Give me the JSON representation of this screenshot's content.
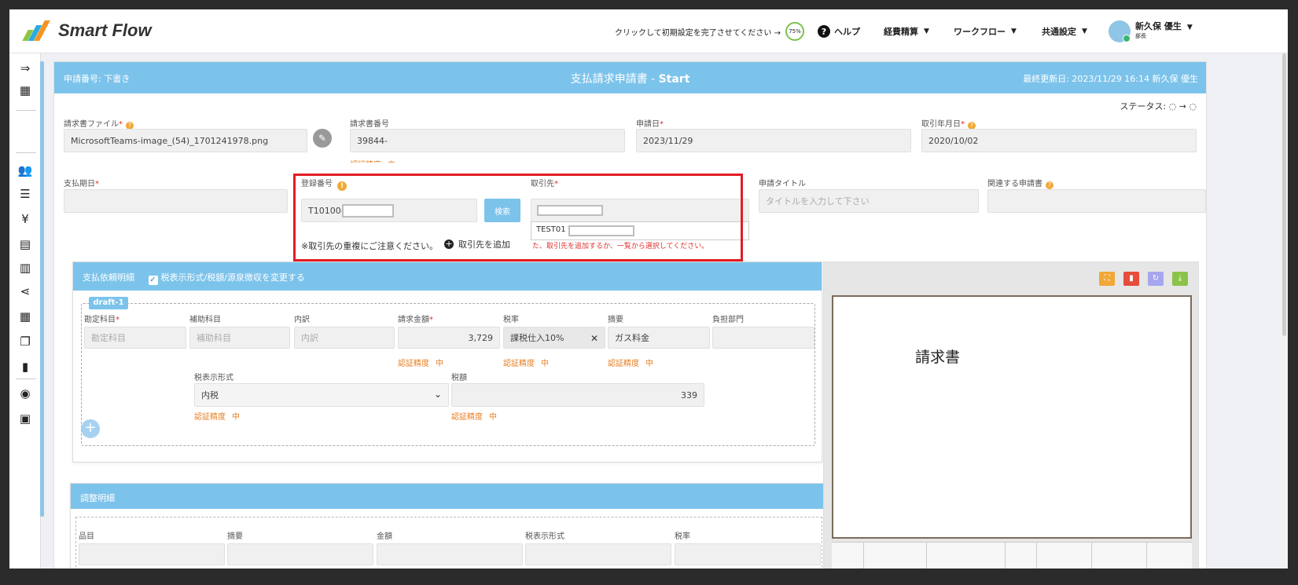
{
  "header": {
    "logo_text": "Smart Flow",
    "setup_prompt": "クリックして初期設定を完了させてください →",
    "setup_progress": "75%",
    "help": "ヘルプ",
    "menus": [
      "経費精算",
      "ワークフロー",
      "共通設定"
    ],
    "user_name": "新久保 優生",
    "user_role": "部長"
  },
  "app": {
    "number": "申請番号: 下書き",
    "title_prefix": "支払請求申請書 - ",
    "title_state": "Start",
    "last_updated": "最終更新日: 2023/11/29 16:14 新久保 優生",
    "status_label": "ステータス:"
  },
  "fields": {
    "invoice_file_label": "請求書ファイル",
    "invoice_file_value": "MicrosoftTeams-image_(54)_1701241978.png",
    "invoice_number_label": "請求書番号",
    "invoice_number_value": "39844-",
    "accuracy_text": "認証精度",
    "accuracy_level": "中",
    "application_date_label": "申請日",
    "application_date_value": "2023/11/29",
    "transaction_date_label": "取引年月日",
    "transaction_date_value": "2020/10/02",
    "payment_due_label": "支払期日",
    "registration_label": "登録番号",
    "registration_value": "T10100(",
    "search_button": "検索",
    "partner_label": "取引先",
    "partner_dropdown_item": "TEST01 :",
    "partner_note": "※取引先の重複にご注意ください。",
    "add_partner": "取引先を追加",
    "partner_hint": "た、取引先を追加するか、一覧から選択してください。",
    "request_title_label": "申請タイトル",
    "request_title_placeholder": "タイトルを入力して下さい",
    "related_label": "関連する申請書"
  },
  "payment_detail": {
    "header": "支払依頼明細",
    "checkbox_label": "税表示形式/税額/源泉徴収を変更する",
    "draft_tag": "draft-1",
    "columns": [
      "勘定科目",
      "補助科目",
      "内訳",
      "請求金額",
      "税率",
      "摘要",
      "負担部門"
    ],
    "account_placeholder": "勘定科目",
    "sub_account_placeholder": "補助科目",
    "breakdown_placeholder": "内訳",
    "amount": "3,729",
    "tax_rate": "課税仕入10%",
    "summary": "ガス料金",
    "tax_format_label": "税表示形式",
    "tax_format_value": "内税",
    "tax_amount_label": "税額",
    "tax_amount_value": "339"
  },
  "adjustment": {
    "header": "調整明細",
    "columns": [
      "品目",
      "摘要",
      "金額",
      "税表示形式",
      "税率"
    ]
  },
  "preview": {
    "doc_title": "請求書"
  },
  "colors": {
    "accent": "#7cc3eb",
    "highlight": "#e31b23",
    "accuracy": "#e67e22"
  }
}
